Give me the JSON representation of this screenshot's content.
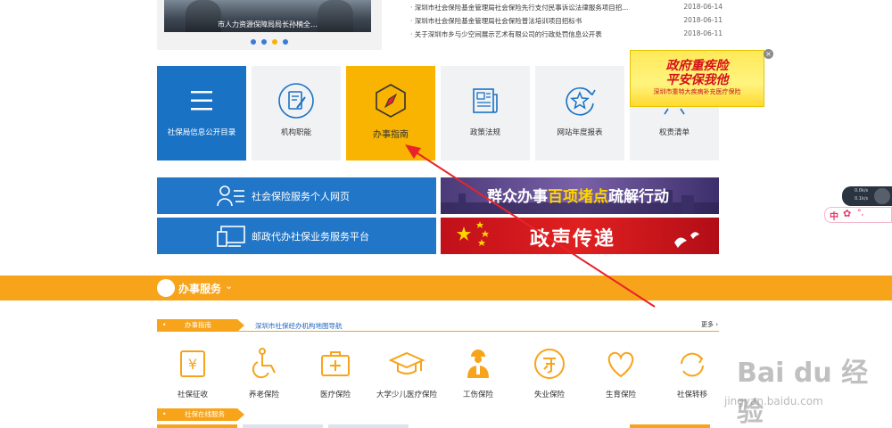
{
  "carousel": {
    "caption": "市人力资源保障局局长孙楠全…",
    "dots": 4,
    "active_dot": 3
  },
  "news": [
    {
      "title": "深圳市社会保险基金管理局社会保险先行支付民事诉讼法律服务项目招...",
      "date": "2018-06-14"
    },
    {
      "title": "深圳市社会保险基金管理局社会保险普法培训项目招标书",
      "date": "2018-06-11"
    },
    {
      "title": "关于深圳市乡与少空间展示艺术有限公司的行政处罚信息公开表",
      "date": "2018-06-11"
    }
  ],
  "tiles": [
    {
      "label": "社保局信息公开目录",
      "icon": "menu-lines-icon",
      "style": "blue"
    },
    {
      "label": "机构职能",
      "icon": "document-edit-icon",
      "style": "gray"
    },
    {
      "label": "办事指南",
      "icon": "compass-icon",
      "style": "orange"
    },
    {
      "label": "政策法规",
      "icon": "newspaper-icon",
      "style": "gray"
    },
    {
      "label": "网站年度报表",
      "icon": "star-badge-icon",
      "style": "gray"
    },
    {
      "label": "权责清单",
      "icon": "list-icon",
      "style": "gray"
    }
  ],
  "ad": {
    "line1": "政府重疾险",
    "line2": "平安保我他",
    "line3": "深圳市重特大疾病补充医疗保险",
    "close": "×"
  },
  "buttons": {
    "personal": "社会保险服务个人网页",
    "postal": "邮政代办社保业务服务平台"
  },
  "banners": {
    "b1_pre": "群众办事",
    "b1_hl": "百项堵点",
    "b1_post": "疏解行动",
    "b2": "政声传递"
  },
  "section": {
    "title": "办事服务",
    "chevron": "⌄",
    "tag": "办事指南",
    "nav_link": "深圳市社保经办机构地图导航",
    "more": "更多 ›",
    "tag2": "社保在线服务"
  },
  "services": [
    {
      "label": "社保征收",
      "icon": "yen-icon"
    },
    {
      "label": "养老保险",
      "icon": "wheelchair-icon"
    },
    {
      "label": "医疗保险",
      "icon": "medical-kit-icon"
    },
    {
      "label": "大学少儿医疗保险",
      "icon": "graduation-cap-icon"
    },
    {
      "label": "工伤保险",
      "icon": "worker-icon"
    },
    {
      "label": "失业保险",
      "icon": "unemployment-icon"
    },
    {
      "label": "生育保险",
      "icon": "heart-icon"
    },
    {
      "label": "社保转移",
      "icon": "transfer-icon"
    }
  ],
  "widgets": {
    "weather_l1": "0.0k/s",
    "weather_l2": "0.1k/s",
    "ime_zh": "中",
    "ime_flower": "✿",
    "ime_punc": "°,"
  },
  "watermark": {
    "logo": "Bai du 经验",
    "url": "jingyan.baidu.com"
  },
  "colors": {
    "blue": "#1a72c5",
    "orange": "#f7a41b",
    "tile_orange": "#f8b401",
    "tile_gray": "#f1f2f4",
    "annotation_red": "#e8232a"
  }
}
